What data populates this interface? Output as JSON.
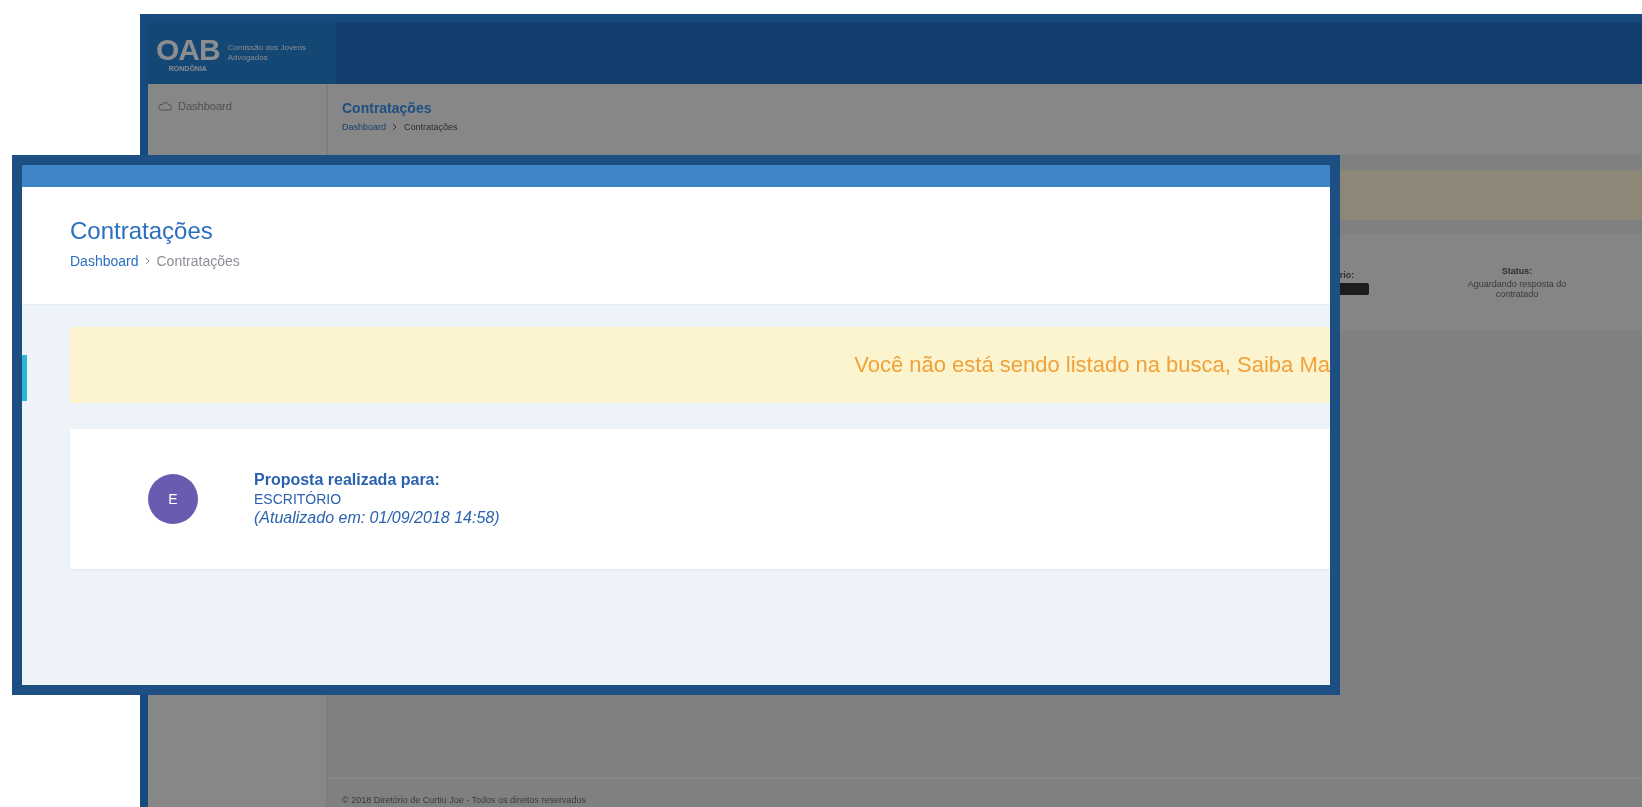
{
  "background_screen": {
    "logo": {
      "mark": "OAB",
      "region": "RONDÔNIA",
      "caption": "Comissão dos Jovens Advogados"
    },
    "sidebar": {
      "items": [
        {
          "label": "Dashboard",
          "selected": false
        }
      ]
    },
    "page_header": {
      "title": "Contratações",
      "breadcrumb": [
        "Dashboard",
        "Contratações"
      ]
    },
    "card": {
      "label_partial": "rio:",
      "status_label": "Status:",
      "status_value": "Aguardando resposta do contratado"
    },
    "footer": "© 2018 Diretório de Curtiu Joe - Todos os direitos reservados"
  },
  "callout": {
    "page_header": {
      "title": "Contratações",
      "breadcrumb": [
        "Dashboard",
        "Contratações"
      ]
    },
    "alert": "Você não está sendo listado na busca, Saiba Ma",
    "proposal": {
      "avatar": "E",
      "heading": "Proposta realizada para:",
      "recipient": "ESCRITÓRIO",
      "updated": "(Atualizado em: 01/09/2018 14:58)"
    }
  }
}
